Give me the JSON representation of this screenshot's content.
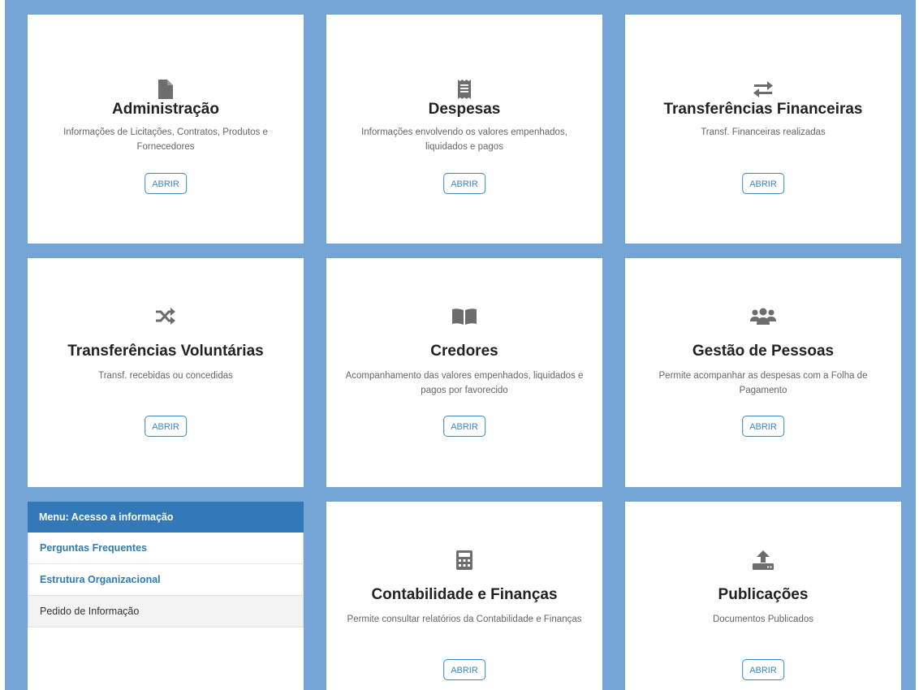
{
  "colors": {
    "frame_background": "#73a6d6",
    "card_background": "#ffffff",
    "button_accent": "#3a86c4",
    "icon_gray": "#6d6d6d",
    "menu_header": "#3479b7",
    "menu_link": "#2f7ab8"
  },
  "cards": [
    {
      "icon": "document-icon",
      "title": "Administração",
      "description": "Informações de Licitações, Contratos, Produtos e Fornecedores",
      "button": "ABRIR"
    },
    {
      "icon": "receipt-icon",
      "title": "Despesas",
      "description": "Informações envolvendo os valores empenhados, liquidados e pagos",
      "button": "ABRIR"
    },
    {
      "icon": "exchange-arrows-icon",
      "title": "Transferências Financeiras",
      "description": "Transf. Financeiras realizadas",
      "button": "ABRIR"
    },
    {
      "icon": "shuffle-icon",
      "title": "Transferências Voluntárias",
      "description": "Transf. recebidas ou concedidas",
      "button": "ABRIR"
    },
    {
      "icon": "book-open-icon",
      "title": "Credores",
      "description": "Acompanhamento das valores empenhados, liquidados e pagos por favorecido",
      "button": "ABRIR"
    },
    {
      "icon": "users-group-icon",
      "title": "Gestão de Pessoas",
      "description": "Permite acompanhar as despesas com a Folha de Pagamento",
      "button": "ABRIR"
    },
    {
      "icon": "calculator-icon",
      "title": "Contabilidade e Finanças",
      "description": "Permite consultar relatórios da Contabilidade e Finanças",
      "button": "ABRIR"
    },
    {
      "icon": "upload-tray-icon",
      "title": "Publicações",
      "description": "Documentos Publicados",
      "button": "ABRIR"
    }
  ],
  "menu": {
    "header": "Menu: Acesso a informação",
    "items": [
      {
        "label": "Perguntas Frequentes"
      },
      {
        "label": "Estrutura Organizacional"
      },
      {
        "label": "Pedido de Informação"
      }
    ]
  }
}
